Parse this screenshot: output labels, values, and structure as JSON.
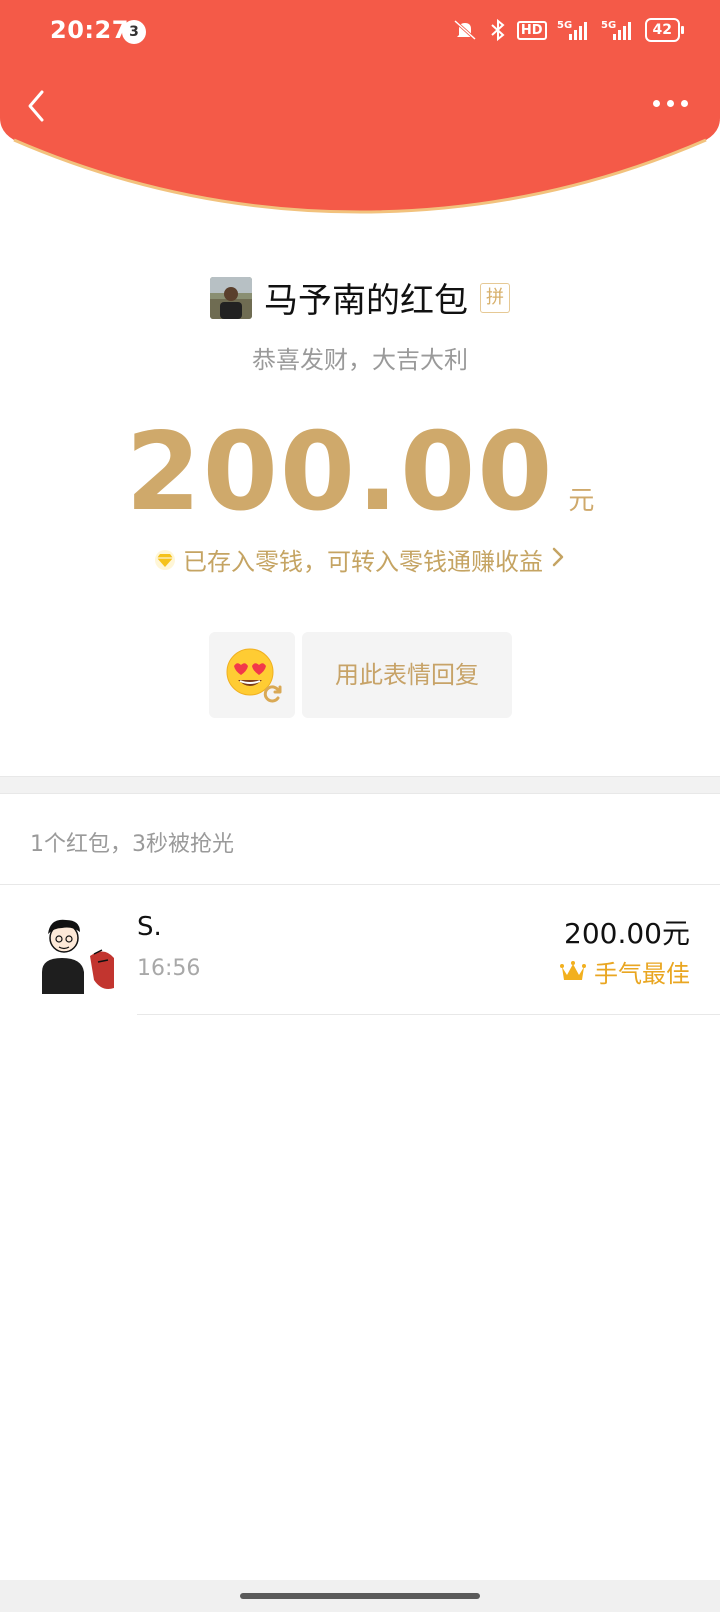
{
  "status_bar": {
    "time": "20:27",
    "notification_count": "3",
    "hd_label": "HD",
    "net1": "5G",
    "net2": "5G",
    "battery": "42"
  },
  "colors": {
    "header_red": "#f45a48",
    "gold": "#cfa96b",
    "crown": "#e9a621"
  },
  "sender": {
    "name": "马予南的红包",
    "badge": "拼",
    "greeting": "恭喜发财，大吉大利"
  },
  "amount": {
    "value": "200.00",
    "unit": "元"
  },
  "change_notice": "已存入零钱，可转入零钱通赚收益",
  "reply": {
    "emoji_icon": "heart-eyes-face-icon",
    "label": "用此表情回复"
  },
  "summary": "1个红包，3秒被抢光",
  "records": [
    {
      "name": "S.",
      "time": "16:56",
      "amount": "200.00元",
      "badge": "手气最佳"
    }
  ]
}
